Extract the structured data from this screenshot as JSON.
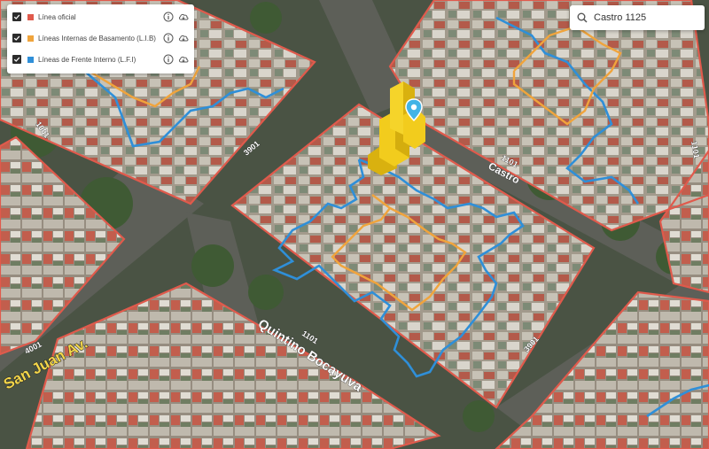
{
  "layers": [
    {
      "label": "Línea oficial",
      "color": "#e05a4c",
      "checked": true
    },
    {
      "label": "Líneas Internas de Basamento (L.I.B)",
      "color": "#f0a43c",
      "checked": true
    },
    {
      "label": "Líneas de Frente Interno (L.F.I)",
      "color": "#2f8fd8",
      "checked": true
    }
  ],
  "search": {
    "value": "Castro 1125",
    "placeholder": ""
  },
  "streets": {
    "castro": "Castro",
    "castro_number": "1101",
    "quintino": "Quintino Bocayuva",
    "quintino_number": "1101",
    "san_juan": "San Juan Av.",
    "san_juan_number": "4001",
    "number_3901_a": "3901",
    "number_3901_b": "3901",
    "number_1001": "1001",
    "number_1101_right": "1101"
  },
  "icons": {
    "info": "info-icon",
    "download": "cloud-download-icon",
    "search": "search-icon",
    "pin": "map-pin-icon"
  },
  "colors": {
    "linea_oficial": "#e05a4c",
    "lib": "#f0a43c",
    "lfi": "#2f8fd8",
    "building": "#f2cc1d",
    "pin": "#42b4e6"
  }
}
